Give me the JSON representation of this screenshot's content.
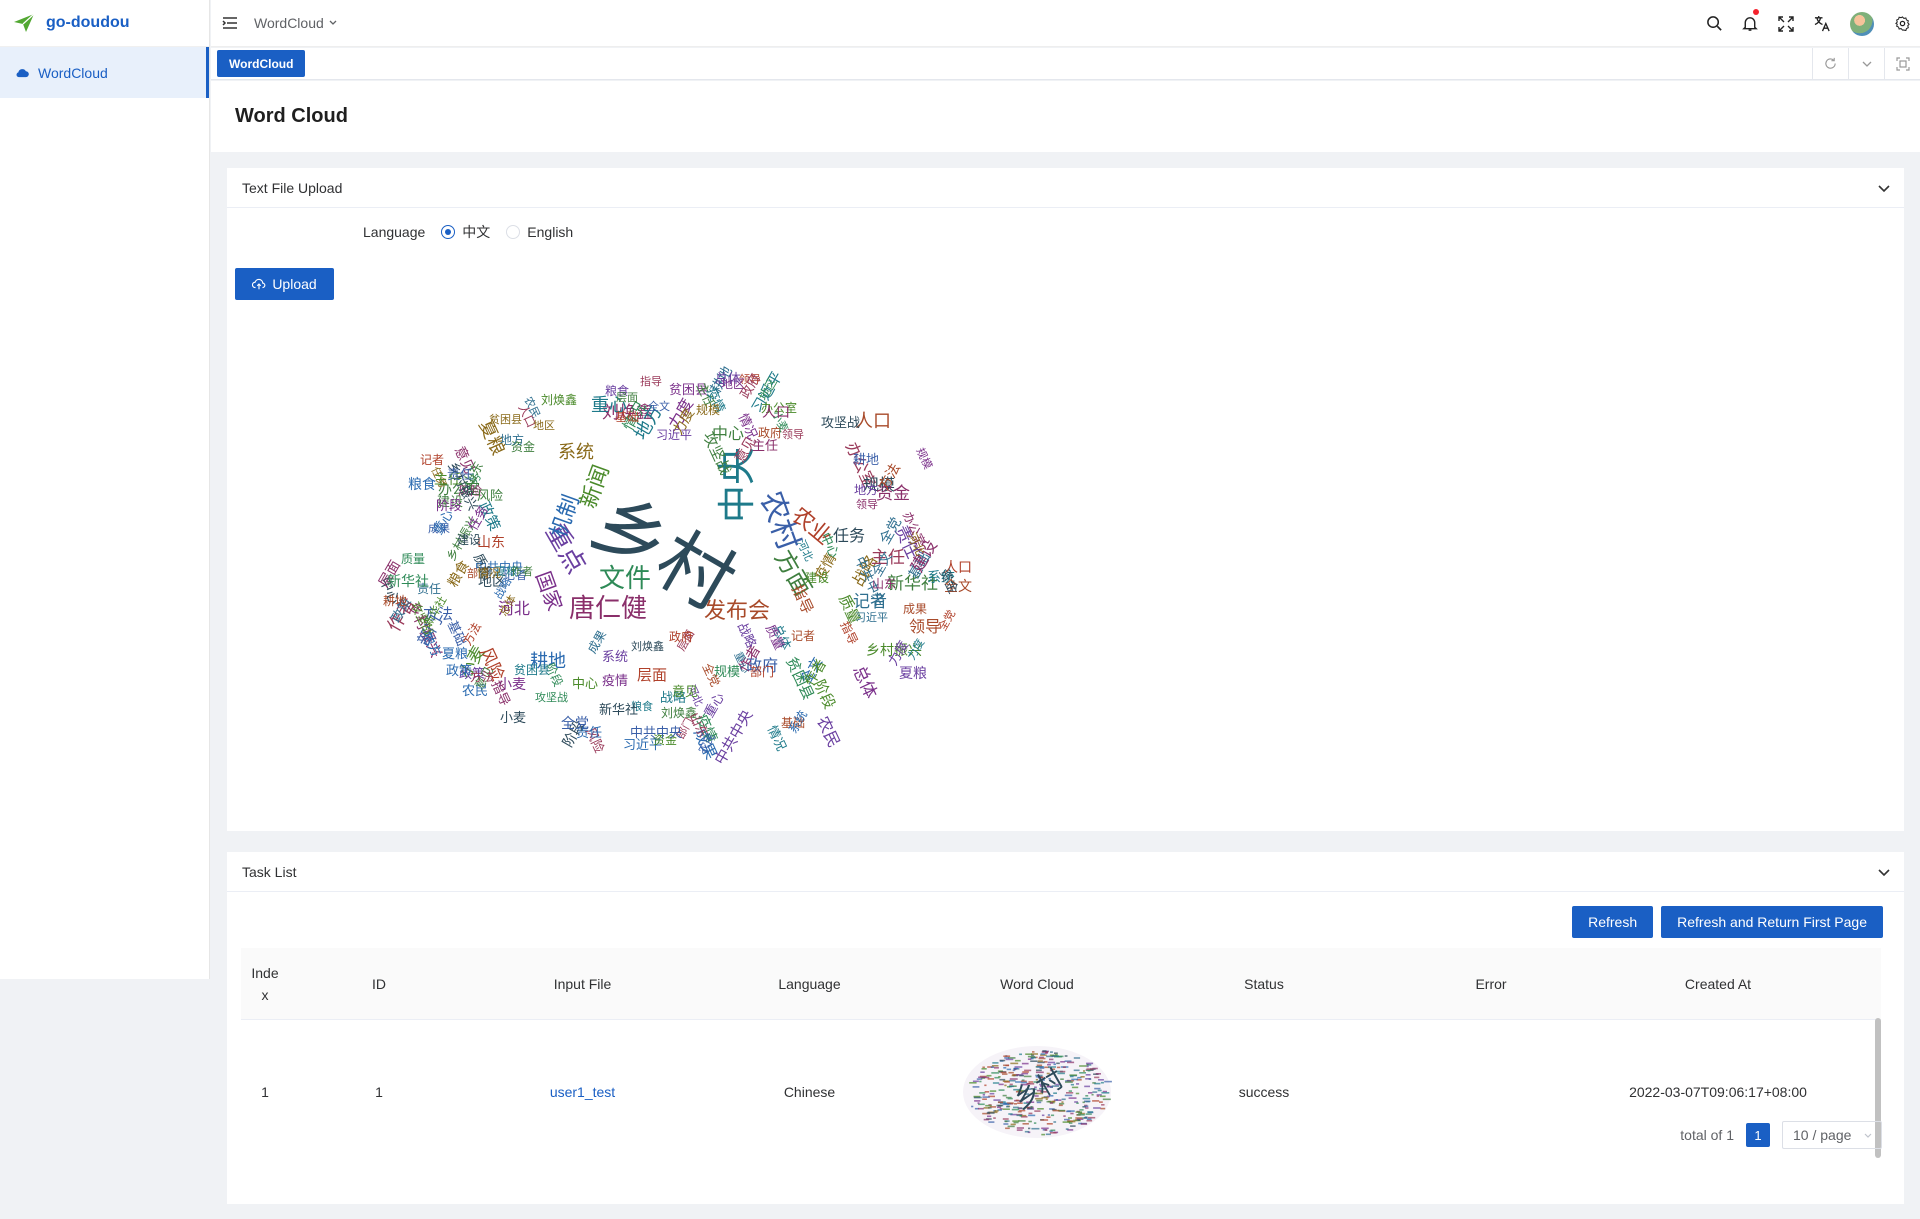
{
  "app": {
    "name": "go-doudou"
  },
  "sidebar": {
    "items": [
      {
        "label": "WordCloud",
        "icon": "cloud-icon"
      }
    ]
  },
  "header": {
    "breadcrumb": "WordCloud",
    "icons": [
      "menu-fold-icon",
      "search-icon",
      "bell-icon",
      "fullscreen-icon",
      "translate-icon",
      "avatar",
      "gear-icon"
    ]
  },
  "tabs": [
    {
      "label": "WordCloud",
      "active": true
    }
  ],
  "page": {
    "title": "Word Cloud"
  },
  "upload_card": {
    "title": "Text File Upload",
    "language_label": "Language",
    "options": [
      {
        "label": "中文",
        "checked": true
      },
      {
        "label": "English",
        "checked": false
      }
    ],
    "upload_label": "Upload",
    "cloud_words": [
      "乡村",
      "中央",
      "农村",
      "唐仁健",
      "文件",
      "重点",
      "发布会",
      "方面",
      "国家",
      "机制",
      "农业",
      "新闻",
      "粮食",
      "办公室",
      "政策",
      "乡村振兴",
      "农民",
      "攻坚战",
      "成果",
      "小麦",
      "记者",
      "任务",
      "部门",
      "疫情",
      "人口",
      "力度",
      "风险",
      "战略",
      "主任",
      "习近平",
      "刘焕鑫",
      "中共中央",
      "新华社",
      "全文",
      "质量",
      "基础",
      "地区",
      "方法",
      "情况",
      "指导",
      "河北",
      "山东",
      "系统",
      "作者",
      "重心",
      "建设",
      "责任",
      "中心",
      "耕地",
      "阶段",
      "全党",
      "规模",
      "政府",
      "贫困县",
      "领导",
      "总体",
      "层面",
      "夏粮",
      "意见",
      "地方",
      "资金"
    ]
  },
  "task_card": {
    "title": "Task List",
    "refresh_label": "Refresh",
    "refresh_first_label": "Refresh and Return First Page",
    "columns": [
      "Index",
      "ID",
      "Input File",
      "Language",
      "Word Cloud",
      "Status",
      "Error",
      "Created At"
    ],
    "rows": [
      {
        "index": "1",
        "id": "1",
        "input_file": "user1_test",
        "language": "Chinese",
        "status": "success",
        "error": "",
        "created_at": "2022-03-07T09:06:17+08:00"
      }
    ],
    "pagination": {
      "total_text": "total of 1",
      "current": "1",
      "page_size": "10 / page"
    }
  },
  "colors": {
    "primary": "#1a5fc4",
    "danger": "#f5222d"
  }
}
